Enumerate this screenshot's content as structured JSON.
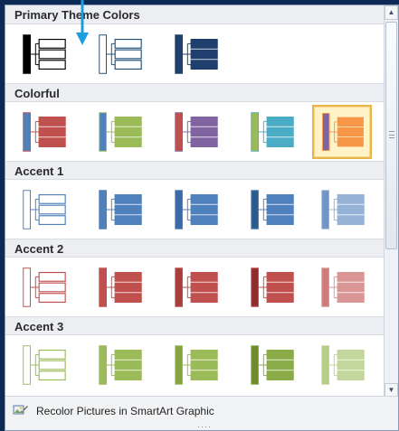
{
  "sections": [
    {
      "title": "Primary Theme Colors",
      "tiles": [
        {
          "bar": "#000000",
          "box": "#000000",
          "fill": "#ffffff",
          "line": "#000000"
        },
        {
          "bar": "#ffffff",
          "box": "#1f4e79",
          "fill": "#ffffff",
          "line": "#1f4e79"
        },
        {
          "bar": "#1f3f6e",
          "box": "#1f3f6e",
          "fill": "#1f3f6e",
          "line": "#1f3f6e"
        }
      ]
    },
    {
      "title": "Colorful",
      "tiles": [
        {
          "bar": "#4f81bd",
          "box": "#c0504d",
          "fill": "#c0504d",
          "line": "#c0504d"
        },
        {
          "bar": "#4f81bd",
          "box": "#9bbb59",
          "fill": "#9bbb59",
          "line": "#9bbb59"
        },
        {
          "bar": "#c0504d",
          "box": "#8064a2",
          "fill": "#8064a2",
          "line": "#8064a2"
        },
        {
          "bar": "#9bbb59",
          "box": "#4bacc6",
          "fill": "#4bacc6",
          "line": "#4bacc6"
        },
        {
          "bar": "#8064a2",
          "box": "#f79646",
          "fill": "#f79646",
          "line": "#f79646",
          "selected": true
        }
      ]
    },
    {
      "title": "Accent 1",
      "tiles": [
        {
          "bar": "#ffffff",
          "box": "#4f81bd",
          "fill": "#ffffff",
          "line": "#4f81bd"
        },
        {
          "bar": "#4f81bd",
          "box": "#4f81bd",
          "fill": "#4f81bd",
          "line": "#4f81bd"
        },
        {
          "bar": "#3a6ba6",
          "box": "#4f81bd",
          "fill": "#4f81bd",
          "line": "#4f81bd"
        },
        {
          "bar": "#2c5a8c",
          "box": "#4f81bd",
          "fill": "#4f81bd",
          "line": "#4f81bd"
        },
        {
          "bar": "#6f95c7",
          "box": "#95b3d7",
          "fill": "#95b3d7",
          "line": "#95b3d7"
        }
      ]
    },
    {
      "title": "Accent 2",
      "tiles": [
        {
          "bar": "#ffffff",
          "box": "#c0504d",
          "fill": "#ffffff",
          "line": "#c0504d"
        },
        {
          "bar": "#c0504d",
          "box": "#c0504d",
          "fill": "#c0504d",
          "line": "#c0504d"
        },
        {
          "bar": "#a83e3b",
          "box": "#c0504d",
          "fill": "#c0504d",
          "line": "#c0504d"
        },
        {
          "bar": "#8e2f2c",
          "box": "#c0504d",
          "fill": "#c0504d",
          "line": "#c0504d"
        },
        {
          "bar": "#d07b79",
          "box": "#d99694",
          "fill": "#d99694",
          "line": "#d99694"
        }
      ]
    },
    {
      "title": "Accent 3",
      "tiles": [
        {
          "bar": "#ffffff",
          "box": "#9bbb59",
          "fill": "#ffffff",
          "line": "#9bbb59"
        },
        {
          "bar": "#9bbb59",
          "box": "#9bbb59",
          "fill": "#9bbb59",
          "line": "#9bbb59"
        },
        {
          "bar": "#82a33e",
          "box": "#9bbb59",
          "fill": "#9bbb59",
          "line": "#9bbb59"
        },
        {
          "bar": "#6c8a2f",
          "box": "#8aab48",
          "fill": "#8aab48",
          "line": "#8aab48"
        },
        {
          "bar": "#b6cf84",
          "box": "#c3d69b",
          "fill": "#c3d69b",
          "line": "#c3d69b"
        }
      ]
    }
  ],
  "footer": {
    "recolor_label": "Recolor Pictures in SmartArt Graphic",
    "recolor_icon": "recolor-pictures-icon"
  },
  "scrollbar": {
    "grip_icon": "scroll-grip-icon"
  },
  "cursor": {
    "color": "#1a9ee0"
  }
}
